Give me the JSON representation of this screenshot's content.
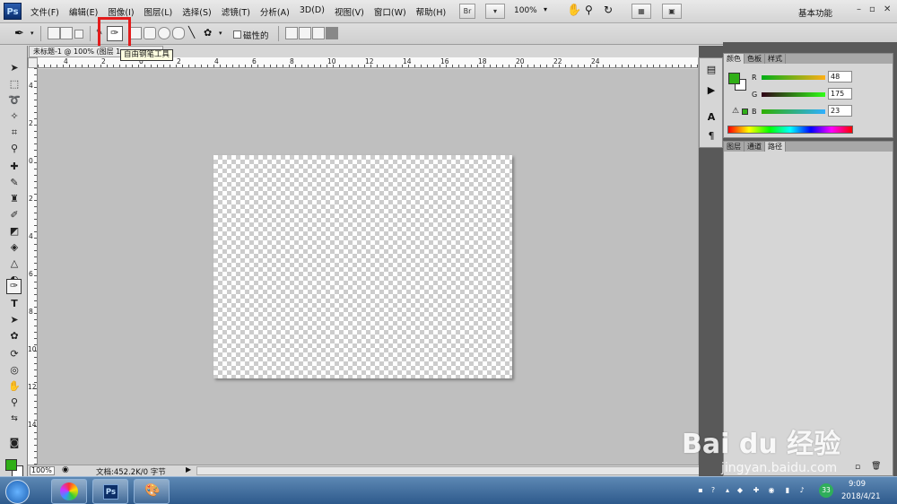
{
  "app": {
    "logo": "Ps"
  },
  "menubar": {
    "items": [
      "文件(F)",
      "编辑(E)",
      "图像(I)",
      "图层(L)",
      "选择(S)",
      "滤镜(T)",
      "分析(A)",
      "3D(D)",
      "视图(V)",
      "窗口(W)",
      "帮助(H)"
    ],
    "bridge_label": "Br",
    "zoom": "100%",
    "workspace": "基本功能",
    "minimize": "–",
    "restore": "▫",
    "close": "✕"
  },
  "options": {
    "magnetic_label": "磁性的",
    "tooltip": "自由钢笔工具"
  },
  "document": {
    "tab_title": "未标题-1 @ 100% (图层 1...",
    "ruler_top": [
      "4",
      "2",
      "0",
      "2",
      "4",
      "6",
      "8",
      "10",
      "12",
      "14",
      "16",
      "18",
      "20",
      "22",
      "24"
    ],
    "ruler_left": [
      "4",
      "2",
      "0",
      "2",
      "4",
      "6",
      "8",
      "10",
      "12",
      "14"
    ]
  },
  "status": {
    "zoom": "100%",
    "doc_info": "文档:452.2K/0 字节"
  },
  "panels": {
    "color_tabs": [
      "颜色",
      "色板",
      "样式"
    ],
    "channels": [
      {
        "label": "R",
        "value": "48"
      },
      {
        "label": "G",
        "value": "175"
      },
      {
        "label": "B",
        "value": "23"
      }
    ],
    "layers_tabs": [
      "图层",
      "通道",
      "路径"
    ]
  },
  "colors": {
    "foreground": "#30af17",
    "background": "#ffffff",
    "highlight": "#e31b1b"
  },
  "taskbar": {
    "ps_label": "Ps",
    "time": "9:09",
    "date": "2018/4/21",
    "badge": "33"
  },
  "watermark": {
    "logo": "Bai du 经验",
    "url": "jingyan.baidu.com"
  }
}
